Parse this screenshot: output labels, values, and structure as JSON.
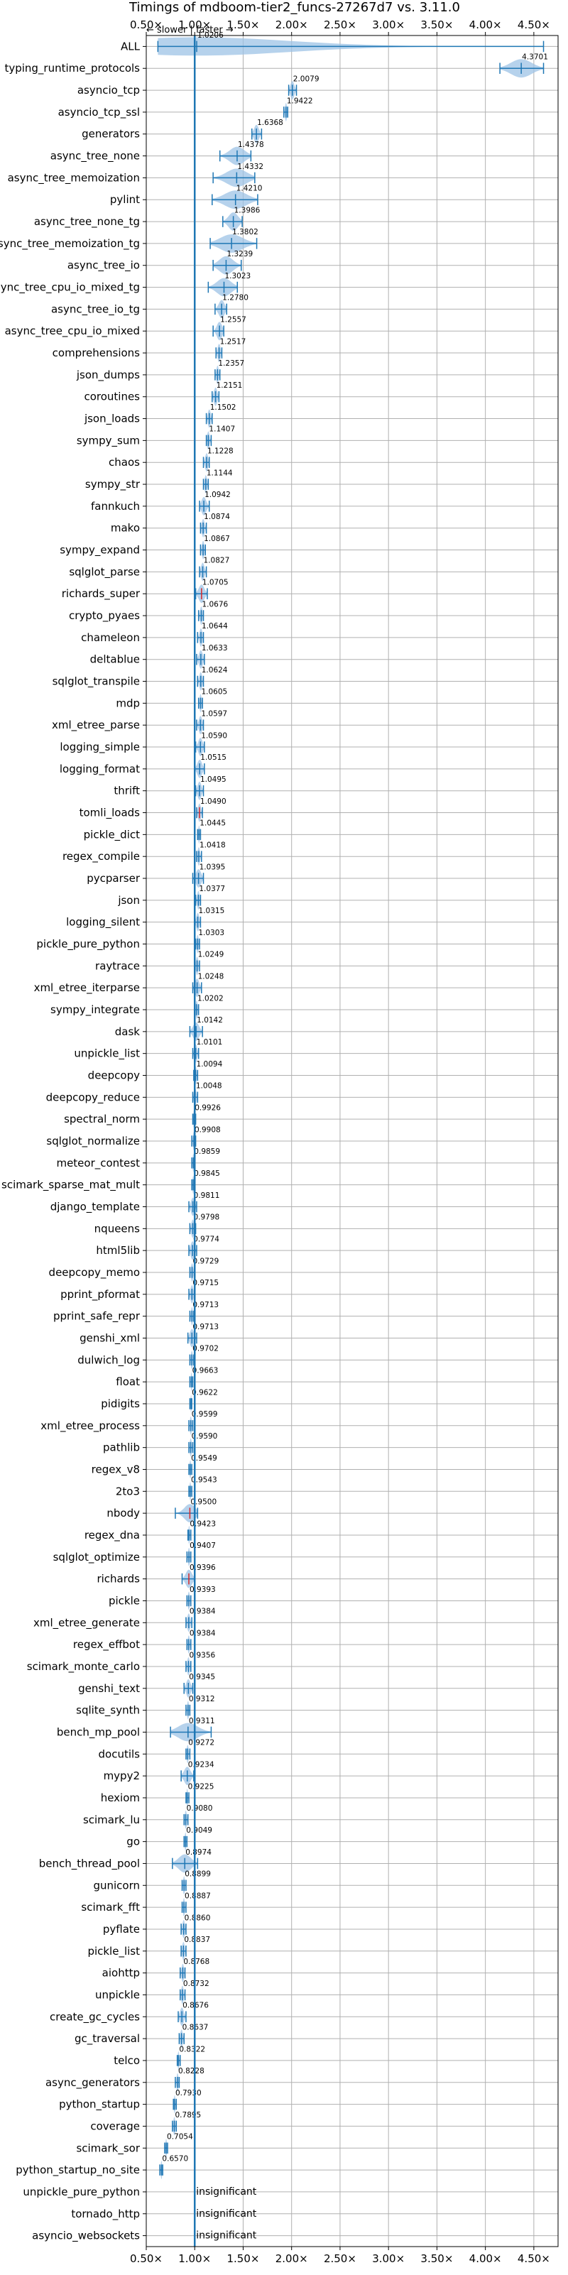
{
  "chart_data": {
    "type": "violin",
    "title": "Timings of mdboom-tier2_funcs-27267d7 vs. 3.11.0",
    "direction_hint": "← slower | faster →",
    "xlim": [
      0.5,
      4.75
    ],
    "x_ticks": [
      0.5,
      1.0,
      1.5,
      2.0,
      2.5,
      3.0,
      3.5,
      4.0,
      4.5
    ],
    "x_tick_labels": [
      "0.50×",
      "1.00×",
      "1.50×",
      "2.00×",
      "2.50×",
      "3.00×",
      "3.50×",
      "4.00×",
      "4.50×"
    ],
    "reference_line": 1.0,
    "grid": true,
    "colors": {
      "violin": "#9dc3e6",
      "median": "#1f77b4",
      "reference": "#1f77b4",
      "grid": "#b0b0b0",
      "outlier_median": "#d62728"
    },
    "insignificant_label": "insignificant",
    "benchmarks": [
      {
        "name": "ALL",
        "ratio": 1.0206,
        "label": "1.0206",
        "lo": 0.62,
        "hi": 4.6
      },
      {
        "name": "typing_runtime_protocols",
        "ratio": 4.3701,
        "label": "4.3701",
        "lo": 4.15,
        "hi": 4.6
      },
      {
        "name": "asyncio_tcp",
        "ratio": 2.0079,
        "label": "2.0079",
        "lo": 1.97,
        "hi": 2.05
      },
      {
        "name": "asyncio_tcp_ssl",
        "ratio": 1.9422,
        "label": "1.9422",
        "lo": 1.92,
        "hi": 1.96
      },
      {
        "name": "generators",
        "ratio": 1.6368,
        "label": "1.6368",
        "lo": 1.59,
        "hi": 1.69
      },
      {
        "name": "async_tree_none",
        "ratio": 1.4378,
        "label": "1.4378",
        "lo": 1.26,
        "hi": 1.58
      },
      {
        "name": "async_tree_memoization",
        "ratio": 1.4332,
        "label": "1.4332",
        "lo": 1.19,
        "hi": 1.62
      },
      {
        "name": "pylint",
        "ratio": 1.421,
        "label": "1.4210",
        "lo": 1.18,
        "hi": 1.65
      },
      {
        "name": "async_tree_none_tg",
        "ratio": 1.3986,
        "label": "1.3986",
        "lo": 1.29,
        "hi": 1.49
      },
      {
        "name": "async_tree_memoization_tg",
        "ratio": 1.3802,
        "label": "1.3802",
        "lo": 1.16,
        "hi": 1.64
      },
      {
        "name": "async_tree_io",
        "ratio": 1.3239,
        "label": "1.3239",
        "lo": 1.19,
        "hi": 1.48
      },
      {
        "name": "async_tree_cpu_io_mixed_tg",
        "ratio": 1.3023,
        "label": "1.3023",
        "lo": 1.14,
        "hi": 1.44
      },
      {
        "name": "async_tree_io_tg",
        "ratio": 1.278,
        "label": "1.2780",
        "lo": 1.21,
        "hi": 1.33
      },
      {
        "name": "async_tree_cpu_io_mixed",
        "ratio": 1.2557,
        "label": "1.2557",
        "lo": 1.19,
        "hi": 1.3
      },
      {
        "name": "comprehensions",
        "ratio": 1.2517,
        "label": "1.2517",
        "lo": 1.22,
        "hi": 1.28
      },
      {
        "name": "json_dumps",
        "ratio": 1.2357,
        "label": "1.2357",
        "lo": 1.21,
        "hi": 1.26
      },
      {
        "name": "coroutines",
        "ratio": 1.2151,
        "label": "1.2151",
        "lo": 1.18,
        "hi": 1.25
      },
      {
        "name": "json_loads",
        "ratio": 1.1502,
        "label": "1.1502",
        "lo": 1.12,
        "hi": 1.18
      },
      {
        "name": "sympy_sum",
        "ratio": 1.1407,
        "label": "1.1407",
        "lo": 1.12,
        "hi": 1.17
      },
      {
        "name": "chaos",
        "ratio": 1.1228,
        "label": "1.1228",
        "lo": 1.09,
        "hi": 1.15
      },
      {
        "name": "sympy_str",
        "ratio": 1.1144,
        "label": "1.1144",
        "lo": 1.09,
        "hi": 1.14
      },
      {
        "name": "fannkuch",
        "ratio": 1.0942,
        "label": "1.0942",
        "lo": 1.05,
        "hi": 1.15
      },
      {
        "name": "mako",
        "ratio": 1.0874,
        "label": "1.0874",
        "lo": 1.06,
        "hi": 1.12
      },
      {
        "name": "sympy_expand",
        "ratio": 1.0867,
        "label": "1.0867",
        "lo": 1.06,
        "hi": 1.11
      },
      {
        "name": "sqlglot_parse",
        "ratio": 1.0827,
        "label": "1.0827",
        "lo": 1.05,
        "hi": 1.12
      },
      {
        "name": "richards_super",
        "ratio": 1.0705,
        "label": "1.0705",
        "lo": 1.01,
        "hi": 1.13,
        "outlier": true
      },
      {
        "name": "crypto_pyaes",
        "ratio": 1.0676,
        "label": "1.0676",
        "lo": 1.04,
        "hi": 1.09
      },
      {
        "name": "chameleon",
        "ratio": 1.0644,
        "label": "1.0644",
        "lo": 1.03,
        "hi": 1.09
      },
      {
        "name": "deltablue",
        "ratio": 1.0633,
        "label": "1.0633",
        "lo": 1.02,
        "hi": 1.1
      },
      {
        "name": "sqlglot_transpile",
        "ratio": 1.0624,
        "label": "1.0624",
        "lo": 1.03,
        "hi": 1.09
      },
      {
        "name": "mdp",
        "ratio": 1.0605,
        "label": "1.0605",
        "lo": 1.04,
        "hi": 1.08
      },
      {
        "name": "xml_etree_parse",
        "ratio": 1.0597,
        "label": "1.0597",
        "lo": 1.02,
        "hi": 1.09
      },
      {
        "name": "logging_simple",
        "ratio": 1.059,
        "label": "1.0590",
        "lo": 1.01,
        "hi": 1.1
      },
      {
        "name": "logging_format",
        "ratio": 1.0515,
        "label": "1.0515",
        "lo": 1.0,
        "hi": 1.1
      },
      {
        "name": "thrift",
        "ratio": 1.0495,
        "label": "1.0495",
        "lo": 1.01,
        "hi": 1.09
      },
      {
        "name": "tomli_loads",
        "ratio": 1.049,
        "label": "1.0490",
        "lo": 1.02,
        "hi": 1.08,
        "outlier": true
      },
      {
        "name": "pickle_dict",
        "ratio": 1.0445,
        "label": "1.0445",
        "lo": 1.03,
        "hi": 1.06
      },
      {
        "name": "regex_compile",
        "ratio": 1.0418,
        "label": "1.0418",
        "lo": 1.02,
        "hi": 1.07
      },
      {
        "name": "pycparser",
        "ratio": 1.0395,
        "label": "1.0395",
        "lo": 0.98,
        "hi": 1.09
      },
      {
        "name": "json",
        "ratio": 1.0377,
        "label": "1.0377",
        "lo": 1.01,
        "hi": 1.06
      },
      {
        "name": "logging_silent",
        "ratio": 1.0315,
        "label": "1.0315",
        "lo": 1.0,
        "hi": 1.06
      },
      {
        "name": "pickle_pure_python",
        "ratio": 1.0303,
        "label": "1.0303",
        "lo": 1.01,
        "hi": 1.05
      },
      {
        "name": "raytrace",
        "ratio": 1.0249,
        "label": "1.0249",
        "lo": 1.0,
        "hi": 1.05
      },
      {
        "name": "xml_etree_iterparse",
        "ratio": 1.0248,
        "label": "1.0248",
        "lo": 0.98,
        "hi": 1.07
      },
      {
        "name": "sympy_integrate",
        "ratio": 1.0202,
        "label": "1.0202",
        "lo": 1.0,
        "hi": 1.04
      },
      {
        "name": "dask",
        "ratio": 1.0142,
        "label": "1.0142",
        "lo": 0.95,
        "hi": 1.08
      },
      {
        "name": "unpickle_list",
        "ratio": 1.0101,
        "label": "1.0101",
        "lo": 0.98,
        "hi": 1.04
      },
      {
        "name": "deepcopy",
        "ratio": 1.0094,
        "label": "1.0094",
        "lo": 0.99,
        "hi": 1.03
      },
      {
        "name": "deepcopy_reduce",
        "ratio": 1.0048,
        "label": "1.0048",
        "lo": 0.98,
        "hi": 1.03
      },
      {
        "name": "spectral_norm",
        "ratio": 0.9926,
        "label": "0.9926",
        "lo": 0.98,
        "hi": 1.01
      },
      {
        "name": "sqlglot_normalize",
        "ratio": 0.9908,
        "label": "0.9908",
        "lo": 0.97,
        "hi": 1.01
      },
      {
        "name": "meteor_contest",
        "ratio": 0.9859,
        "label": "0.9859",
        "lo": 0.97,
        "hi": 1.0
      },
      {
        "name": "scimark_sparse_mat_mult",
        "ratio": 0.9845,
        "label": "0.9845",
        "lo": 0.97,
        "hi": 1.0
      },
      {
        "name": "django_template",
        "ratio": 0.9811,
        "label": "0.9811",
        "lo": 0.94,
        "hi": 1.02
      },
      {
        "name": "nqueens",
        "ratio": 0.9798,
        "label": "0.9798",
        "lo": 0.95,
        "hi": 1.01
      },
      {
        "name": "html5lib",
        "ratio": 0.9774,
        "label": "0.9774",
        "lo": 0.94,
        "hi": 1.02
      },
      {
        "name": "deepcopy_memo",
        "ratio": 0.9729,
        "label": "0.9729",
        "lo": 0.95,
        "hi": 1.0
      },
      {
        "name": "pprint_pformat",
        "ratio": 0.9715,
        "label": "0.9715",
        "lo": 0.94,
        "hi": 1.0
      },
      {
        "name": "pprint_safe_repr",
        "ratio": 0.9713,
        "label": "0.9713",
        "lo": 0.95,
        "hi": 0.99
      },
      {
        "name": "genshi_xml",
        "ratio": 0.9713,
        "label": "0.9713",
        "lo": 0.93,
        "hi": 1.02
      },
      {
        "name": "dulwich_log",
        "ratio": 0.9702,
        "label": "0.9702",
        "lo": 0.95,
        "hi": 0.99
      },
      {
        "name": "float",
        "ratio": 0.9663,
        "label": "0.9663",
        "lo": 0.95,
        "hi": 0.98
      },
      {
        "name": "pidigits",
        "ratio": 0.9622,
        "label": "0.9622",
        "lo": 0.95,
        "hi": 0.97
      },
      {
        "name": "xml_etree_process",
        "ratio": 0.9599,
        "label": "0.9599",
        "lo": 0.94,
        "hi": 0.98
      },
      {
        "name": "pathlib",
        "ratio": 0.959,
        "label": "0.9590",
        "lo": 0.94,
        "hi": 0.98
      },
      {
        "name": "regex_v8",
        "ratio": 0.9549,
        "label": "0.9549",
        "lo": 0.94,
        "hi": 0.97
      },
      {
        "name": "2to3",
        "ratio": 0.9543,
        "label": "0.9543",
        "lo": 0.94,
        "hi": 0.97
      },
      {
        "name": "nbody",
        "ratio": 0.95,
        "label": "0.9500",
        "lo": 0.8,
        "hi": 1.03,
        "outlier": true
      },
      {
        "name": "regex_dna",
        "ratio": 0.9423,
        "label": "0.9423",
        "lo": 0.93,
        "hi": 0.96
      },
      {
        "name": "sqlglot_optimize",
        "ratio": 0.9407,
        "label": "0.9407",
        "lo": 0.92,
        "hi": 0.96
      },
      {
        "name": "richards",
        "ratio": 0.9396,
        "label": "0.9396",
        "lo": 0.87,
        "hi": 1.0,
        "outlier": true
      },
      {
        "name": "pickle",
        "ratio": 0.9393,
        "label": "0.9393",
        "lo": 0.92,
        "hi": 0.96
      },
      {
        "name": "xml_etree_generate",
        "ratio": 0.9384,
        "label": "0.9384",
        "lo": 0.91,
        "hi": 0.97
      },
      {
        "name": "regex_effbot",
        "ratio": 0.9384,
        "label": "0.9384",
        "lo": 0.92,
        "hi": 0.96
      },
      {
        "name": "scimark_monte_carlo",
        "ratio": 0.9356,
        "label": "0.9356",
        "lo": 0.91,
        "hi": 0.96
      },
      {
        "name": "genshi_text",
        "ratio": 0.9345,
        "label": "0.9345",
        "lo": 0.89,
        "hi": 0.98
      },
      {
        "name": "sqlite_synth",
        "ratio": 0.9312,
        "label": "0.9312",
        "lo": 0.91,
        "hi": 0.95
      },
      {
        "name": "bench_mp_pool",
        "ratio": 0.9311,
        "label": "0.9311",
        "lo": 0.75,
        "hi": 1.17
      },
      {
        "name": "docutils",
        "ratio": 0.9272,
        "label": "0.9272",
        "lo": 0.91,
        "hi": 0.95
      },
      {
        "name": "mypy2",
        "ratio": 0.9234,
        "label": "0.9234",
        "lo": 0.86,
        "hi": 0.99
      },
      {
        "name": "hexiom",
        "ratio": 0.9225,
        "label": "0.9225",
        "lo": 0.91,
        "hi": 0.94
      },
      {
        "name": "scimark_lu",
        "ratio": 0.908,
        "label": "0.9080",
        "lo": 0.89,
        "hi": 0.93
      },
      {
        "name": "go",
        "ratio": 0.9049,
        "label": "0.9049",
        "lo": 0.89,
        "hi": 0.92
      },
      {
        "name": "bench_thread_pool",
        "ratio": 0.8974,
        "label": "0.8974",
        "lo": 0.77,
        "hi": 1.03
      },
      {
        "name": "gunicorn",
        "ratio": 0.8899,
        "label": "0.8899",
        "lo": 0.87,
        "hi": 0.91
      },
      {
        "name": "scimark_fft",
        "ratio": 0.8887,
        "label": "0.8887",
        "lo": 0.87,
        "hi": 0.91
      },
      {
        "name": "pyflate",
        "ratio": 0.886,
        "label": "0.8860",
        "lo": 0.86,
        "hi": 0.91
      },
      {
        "name": "pickle_list",
        "ratio": 0.8837,
        "label": "0.8837",
        "lo": 0.86,
        "hi": 0.91
      },
      {
        "name": "aiohttp",
        "ratio": 0.8768,
        "label": "0.8768",
        "lo": 0.85,
        "hi": 0.9
      },
      {
        "name": "unpickle",
        "ratio": 0.8732,
        "label": "0.8732",
        "lo": 0.85,
        "hi": 0.9
      },
      {
        "name": "create_gc_cycles",
        "ratio": 0.8676,
        "label": "0.8676",
        "lo": 0.83,
        "hi": 0.91
      },
      {
        "name": "gc_traversal",
        "ratio": 0.8637,
        "label": "0.8637",
        "lo": 0.84,
        "hi": 0.89
      },
      {
        "name": "telco",
        "ratio": 0.8322,
        "label": "0.8322",
        "lo": 0.82,
        "hi": 0.85
      },
      {
        "name": "async_generators",
        "ratio": 0.8228,
        "label": "0.8228",
        "lo": 0.8,
        "hi": 0.84
      },
      {
        "name": "python_startup",
        "ratio": 0.793,
        "label": "0.7930",
        "lo": 0.78,
        "hi": 0.81
      },
      {
        "name": "coverage",
        "ratio": 0.7895,
        "label": "0.7895",
        "lo": 0.77,
        "hi": 0.81
      },
      {
        "name": "scimark_sor",
        "ratio": 0.7054,
        "label": "0.7054",
        "lo": 0.69,
        "hi": 0.72
      },
      {
        "name": "python_startup_no_site",
        "ratio": 0.657,
        "label": "0.6570",
        "lo": 0.64,
        "hi": 0.67
      },
      {
        "name": "unpickle_pure_python",
        "insignificant": true
      },
      {
        "name": "tornado_http",
        "insignificant": true
      },
      {
        "name": "asyncio_websockets",
        "insignificant": true
      }
    ]
  }
}
